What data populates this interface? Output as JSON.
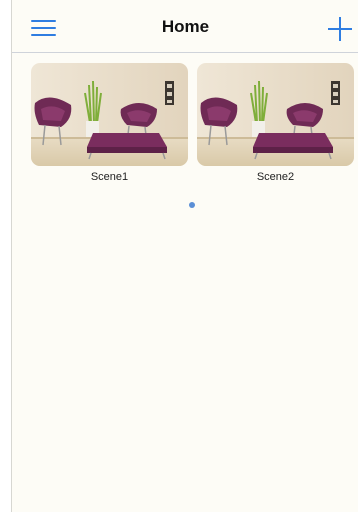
{
  "header": {
    "title": "Home",
    "menu_icon": "hamburger-menu-icon",
    "add_icon": "plus-icon",
    "accent_color": "#2f7de1"
  },
  "scenes": [
    {
      "label": "Scene1"
    },
    {
      "label": "Scene2"
    }
  ],
  "pager": {
    "pages": 1,
    "current": 1
  }
}
